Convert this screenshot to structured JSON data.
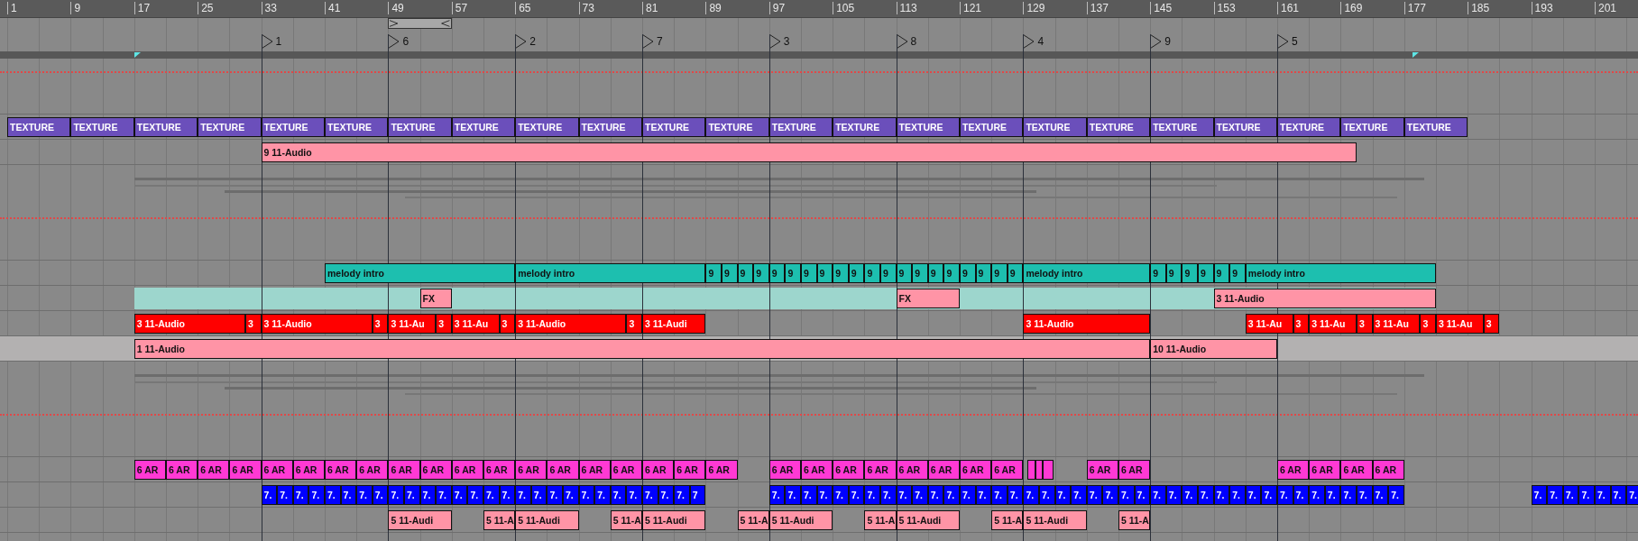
{
  "ruler": {
    "bars": [
      "1",
      "9",
      "17",
      "25",
      "33",
      "41",
      "49",
      "57",
      "65",
      "73",
      "81",
      "89",
      "97",
      "105",
      "113",
      "121",
      "129",
      "137",
      "145",
      "153",
      "161",
      "169",
      "177",
      "185",
      "193",
      "201"
    ]
  },
  "locators": [
    {
      "label": "1"
    },
    {
      "label": "6"
    },
    {
      "label": "2"
    },
    {
      "label": "7"
    },
    {
      "label": "3"
    },
    {
      "label": "8"
    },
    {
      "label": "4"
    },
    {
      "label": "9"
    },
    {
      "label": "5"
    }
  ],
  "tracks": [
    {
      "kind": "tempo-lane",
      "selected": false
    },
    {
      "kind": "clips",
      "selected": false,
      "color": "#6b4fbb",
      "clips": [
        {
          "name": "TEXTURE"
        },
        {
          "name": "TEXTURE"
        },
        {
          "name": "TEXTURE"
        },
        {
          "name": "TEXTURE"
        },
        {
          "name": "TEXTURE"
        },
        {
          "name": "TEXTURE"
        },
        {
          "name": "TEXTURE"
        },
        {
          "name": "TEXTURE"
        },
        {
          "name": "TEXTURE"
        },
        {
          "name": "TEXTURE"
        },
        {
          "name": "TEXTURE"
        },
        {
          "name": "TEXTURE"
        },
        {
          "name": "TEXTURE"
        },
        {
          "name": "TEXTURE"
        },
        {
          "name": "TEXTURE"
        },
        {
          "name": "TEXTURE"
        },
        {
          "name": "TEXTURE"
        },
        {
          "name": "TEXTURE"
        },
        {
          "name": "TEXTURE"
        },
        {
          "name": "TEXTURE"
        },
        {
          "name": "TEXTURE"
        },
        {
          "name": "TEXTURE"
        },
        {
          "name": "TEXTURE"
        }
      ]
    },
    {
      "kind": "clips",
      "selected": false,
      "color": "#ff94a6",
      "clips": [
        {
          "name": "9 11-Audio"
        }
      ]
    },
    {
      "kind": "envelope-lane",
      "selected": false
    },
    {
      "kind": "clips",
      "selected": false,
      "color": "#1dbfaf",
      "clips": [
        {
          "name": "melody intro"
        },
        {
          "name": "melody intro"
        },
        {
          "name": "9"
        },
        {
          "name": "9"
        },
        {
          "name": "9"
        },
        {
          "name": "9"
        },
        {
          "name": "9"
        },
        {
          "name": "9"
        },
        {
          "name": "9"
        },
        {
          "name": "9"
        },
        {
          "name": "9"
        },
        {
          "name": "9"
        },
        {
          "name": "9"
        },
        {
          "name": "9"
        },
        {
          "name": "9"
        },
        {
          "name": "9"
        },
        {
          "name": "9"
        },
        {
          "name": "9"
        },
        {
          "name": "9"
        },
        {
          "name": "9"
        },
        {
          "name": "9"
        },
        {
          "name": "9"
        },
        {
          "name": "melody intro"
        },
        {
          "name": "9"
        },
        {
          "name": "9"
        },
        {
          "name": "9"
        },
        {
          "name": "9"
        },
        {
          "name": "9"
        },
        {
          "name": "9"
        },
        {
          "name": "melody intro"
        }
      ]
    },
    {
      "kind": "clips",
      "selected": false,
      "color": "#ff94a6",
      "region": {
        "color": "#9dd6cd"
      },
      "clips": [
        {
          "name": "FX"
        },
        {
          "name": "FX"
        },
        {
          "name": "3 11-Audio"
        }
      ]
    },
    {
      "kind": "clips",
      "selected": false,
      "color": "#ff0000",
      "clips": [
        {
          "name": "3 11-Audio"
        },
        {
          "name": "3"
        },
        {
          "name": "3 11-Audio"
        },
        {
          "name": "3"
        },
        {
          "name": "3 11-Au"
        },
        {
          "name": "3"
        },
        {
          "name": "3 11-Au"
        },
        {
          "name": "3"
        },
        {
          "name": "3 11-Audio"
        },
        {
          "name": "3"
        },
        {
          "name": "3 11-Audi"
        },
        {
          "name": "3 11-Audio"
        },
        {
          "name": "3 11-Au"
        },
        {
          "name": "3"
        },
        {
          "name": "3 11-Au"
        },
        {
          "name": "3"
        },
        {
          "name": "3 11-Au"
        },
        {
          "name": "3"
        },
        {
          "name": "3 11-Au"
        },
        {
          "name": "3"
        }
      ]
    },
    {
      "kind": "clips",
      "selected": true,
      "color": "#ff94a6",
      "clips": [
        {
          "name": "1 11-Audio"
        },
        {
          "name": "10 11-Audio"
        }
      ]
    },
    {
      "kind": "envelope-lane",
      "selected": false
    },
    {
      "kind": "clips",
      "selected": false,
      "color": "#ff39d4",
      "clips": [
        {
          "name": "6 AR"
        },
        {
          "name": "6 AR"
        },
        {
          "name": "6 AR"
        },
        {
          "name": "6 AR"
        },
        {
          "name": "6 AR"
        },
        {
          "name": "6 AR"
        },
        {
          "name": "6 AR"
        },
        {
          "name": "6 AR"
        },
        {
          "name": "6 AR"
        },
        {
          "name": "6 AR"
        },
        {
          "name": "6 AR"
        },
        {
          "name": "6 AR"
        },
        {
          "name": "6 AR"
        },
        {
          "name": "6 AR"
        },
        {
          "name": "6 AR"
        },
        {
          "name": "6 AR"
        },
        {
          "name": "6 AR"
        },
        {
          "name": "6 AR"
        },
        {
          "name": "6 AR"
        },
        {
          "name": "6 AR"
        },
        {
          "name": "6 AR"
        },
        {
          "name": "6 AR"
        },
        {
          "name": "6 AR"
        },
        {
          "name": "6 AR"
        },
        {
          "name": "6 AR"
        },
        {
          "name": "6 AR"
        },
        {
          "name": "6 AR"
        },
        {
          "name": "6 AR"
        },
        {
          "name": "6 AR"
        },
        {
          "name": "6 AR"
        },
        {
          "name": "6 AR"
        },
        {
          "name": "6 AR"
        },
        {
          "name": "6 AR"
        }
      ]
    },
    {
      "kind": "clips",
      "selected": false,
      "color": "#0000ff",
      "clips": [
        {
          "name": "7."
        },
        {
          "name": "7."
        },
        {
          "name": "7."
        },
        {
          "name": "7."
        },
        {
          "name": "7."
        },
        {
          "name": "7."
        },
        {
          "name": "7."
        },
        {
          "name": "7."
        },
        {
          "name": "7."
        },
        {
          "name": "7."
        },
        {
          "name": "7."
        },
        {
          "name": "7."
        },
        {
          "name": "7."
        },
        {
          "name": "7."
        },
        {
          "name": "7."
        },
        {
          "name": "7."
        },
        {
          "name": "7."
        },
        {
          "name": "7."
        },
        {
          "name": "7."
        },
        {
          "name": "7."
        },
        {
          "name": "7."
        },
        {
          "name": "7."
        },
        {
          "name": "7."
        },
        {
          "name": "7."
        },
        {
          "name": "7."
        },
        {
          "name": "7."
        },
        {
          "name": "7."
        },
        {
          "name": "7"
        },
        {
          "name": "7."
        },
        {
          "name": "7."
        },
        {
          "name": "7."
        },
        {
          "name": "7."
        },
        {
          "name": "7."
        },
        {
          "name": "7."
        },
        {
          "name": "7."
        },
        {
          "name": "7."
        },
        {
          "name": "7."
        },
        {
          "name": "7."
        },
        {
          "name": "7."
        },
        {
          "name": "7."
        },
        {
          "name": "7."
        },
        {
          "name": "7."
        },
        {
          "name": "7."
        },
        {
          "name": "7."
        },
        {
          "name": "7."
        },
        {
          "name": "7."
        },
        {
          "name": "7."
        },
        {
          "name": "7."
        },
        {
          "name": "7."
        },
        {
          "name": "7."
        },
        {
          "name": "7."
        },
        {
          "name": "7."
        },
        {
          "name": "7."
        },
        {
          "name": "7."
        },
        {
          "name": "7."
        },
        {
          "name": "7."
        },
        {
          "name": "7."
        },
        {
          "name": "7."
        },
        {
          "name": "7."
        },
        {
          "name": "7."
        },
        {
          "name": "7."
        },
        {
          "name": "7."
        },
        {
          "name": "7."
        },
        {
          "name": "7."
        },
        {
          "name": "7."
        },
        {
          "name": "7."
        },
        {
          "name": "7."
        },
        {
          "name": "7."
        },
        {
          "name": "7."
        },
        {
          "name": "7."
        },
        {
          "name": "7."
        },
        {
          "name": "7."
        },
        {
          "name": "7."
        },
        {
          "name": "7."
        },
        {
          "name": "7."
        }
      ]
    },
    {
      "kind": "clips",
      "selected": false,
      "color": "#ff94a6",
      "clips": [
        {
          "name": "5 11-Audi"
        },
        {
          "name": "5 11-A"
        },
        {
          "name": "5 11-Audi"
        },
        {
          "name": "5 11-A"
        },
        {
          "name": "5 11-Audi"
        },
        {
          "name": "5 11-A"
        },
        {
          "name": "5 11-Audi"
        },
        {
          "name": "5 11-A"
        },
        {
          "name": "5 11-Audi"
        },
        {
          "name": "5 11-A"
        },
        {
          "name": "5 11-Audi"
        },
        {
          "name": "5 11-A"
        }
      ]
    }
  ]
}
